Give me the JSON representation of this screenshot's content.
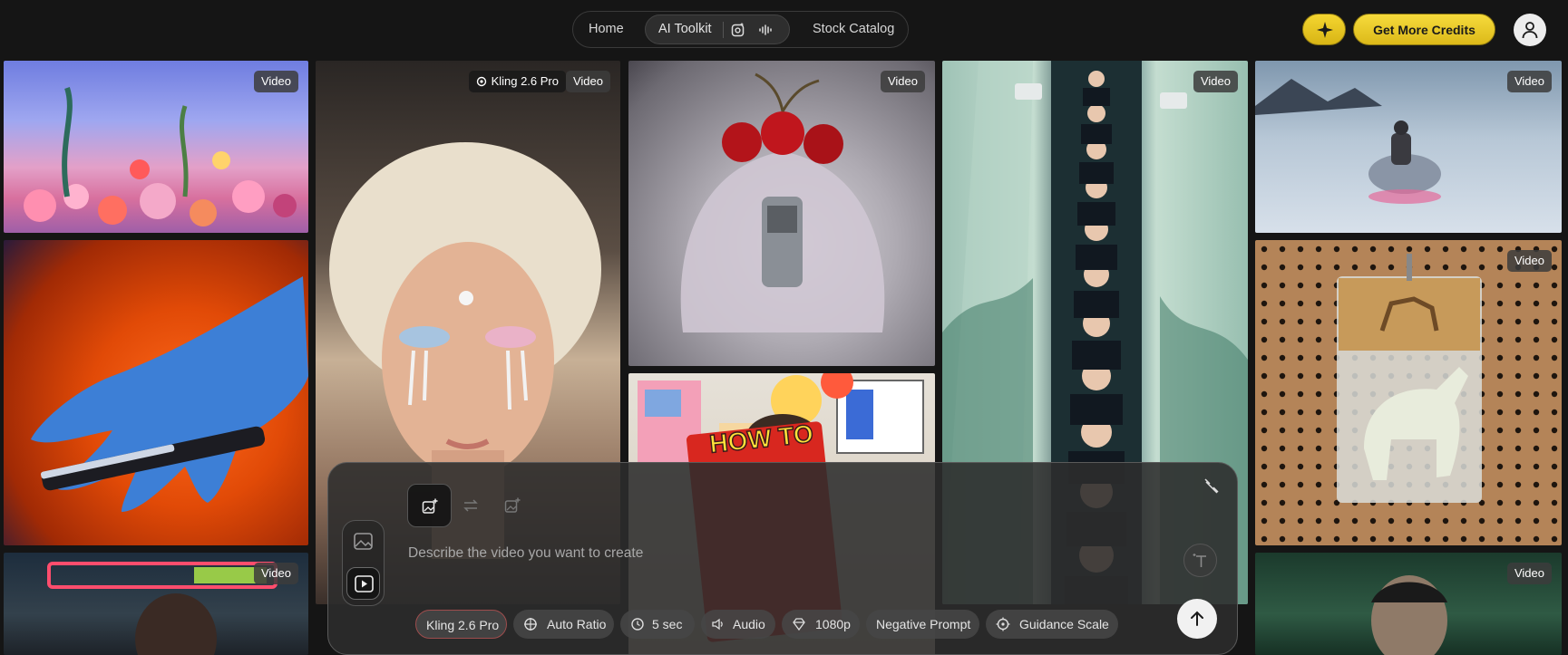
{
  "nav": {
    "home": "Home",
    "ai_toolkit": "AI Toolkit",
    "stock_catalog": "Stock Catalog"
  },
  "header": {
    "credits_button": "Get More Credits"
  },
  "gallery": {
    "badge": "Video",
    "model_badge": "Kling 2.6 Pro",
    "book_text": "HOW TO"
  },
  "composer": {
    "placeholder": "Describe the video you want to create",
    "options": {
      "model": "Kling 2.6 Pro",
      "ratio": "Auto Ratio",
      "duration": "5 sec",
      "audio": "Audio",
      "resolution": "1080p",
      "negative_prompt": "Negative Prompt",
      "guidance_scale": "Guidance Scale"
    }
  },
  "colors": {
    "accent_yellow": "#f6db3c",
    "background": "#151515"
  }
}
